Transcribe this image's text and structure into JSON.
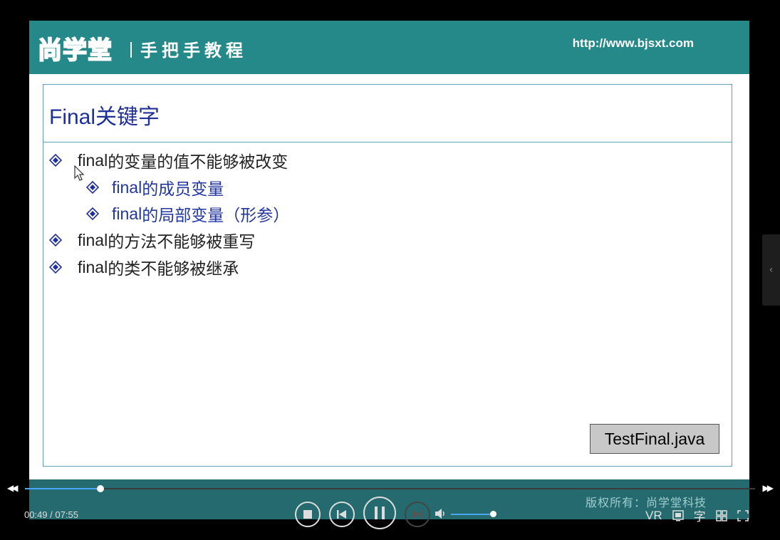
{
  "slide": {
    "logo_text": "尚学堂",
    "subtitle": "手把手教程",
    "url": "http://www.bjsxt.com",
    "title": "Final关键字",
    "bullets": [
      {
        "level": 1,
        "text_en": "final",
        "text_cn": "的变量的值不能够被改变"
      },
      {
        "level": 2,
        "text_en": "final",
        "text_cn": "的成员变量"
      },
      {
        "level": 2,
        "text_en": "final",
        "text_cn": "的局部变量（形参）"
      },
      {
        "level": 1,
        "text_en": "final",
        "text_cn": "的方法不能够被重写"
      },
      {
        "level": 1,
        "text_en": "final",
        "text_cn": "的类不能够被继承"
      }
    ],
    "file_label": "TestFinal.java"
  },
  "player": {
    "current_time": "00:49",
    "separator": " / ",
    "total_time": "07:55",
    "progress_fraction": 0.103,
    "volume_fraction": 0.95,
    "copyright": "版权所有：尚学堂科技",
    "tools": {
      "vr": "VR",
      "subtitle": "字"
    },
    "accent_color": "#4aa6ff",
    "header_color": "#25898a"
  }
}
